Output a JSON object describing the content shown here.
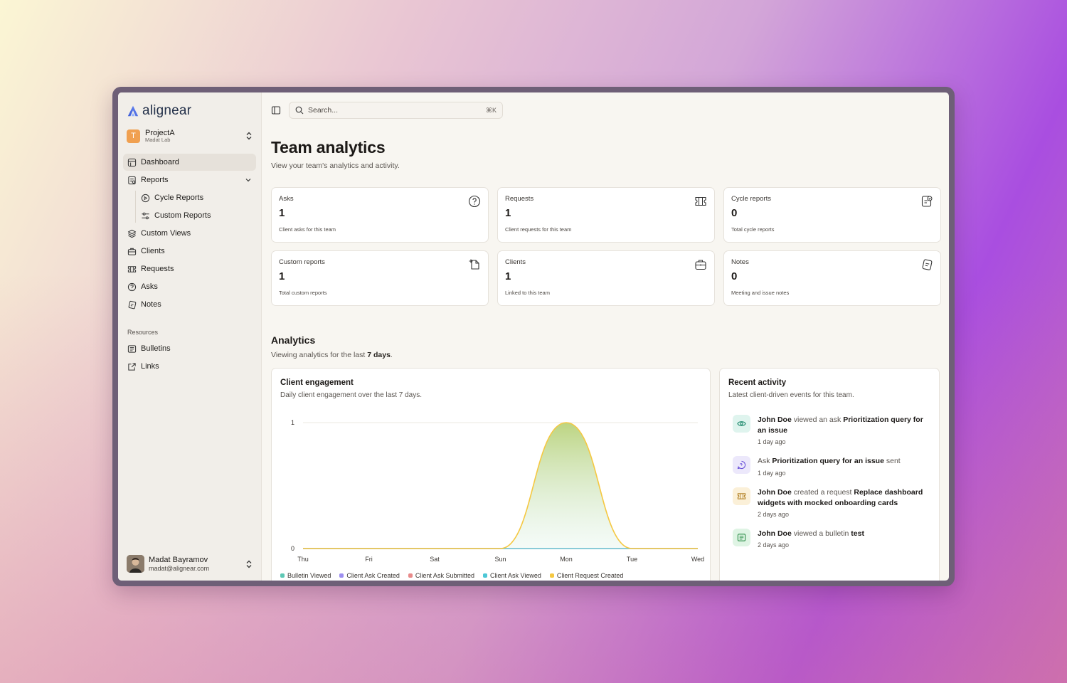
{
  "app": {
    "brand": "alignear",
    "project": {
      "initial": "T",
      "name": "ProjectA",
      "org": "Madat Lab"
    },
    "user": {
      "name": "Madat Bayramov",
      "email": "madat@alignear.com"
    }
  },
  "sidebar": {
    "items": [
      {
        "label": "Dashboard",
        "icon": "dashboard-icon",
        "active": true
      },
      {
        "label": "Reports",
        "icon": "reports-icon"
      },
      {
        "label": "Cycle Reports",
        "icon": "cycle-icon"
      },
      {
        "label": "Custom Reports",
        "icon": "sliders-icon"
      },
      {
        "label": "Custom Views",
        "icon": "layers-icon"
      },
      {
        "label": "Clients",
        "icon": "briefcase-icon"
      },
      {
        "label": "Requests",
        "icon": "ticket-icon"
      },
      {
        "label": "Asks",
        "icon": "help-circle-icon"
      },
      {
        "label": "Notes",
        "icon": "notes-icon"
      }
    ],
    "resources_label": "Resources",
    "resources": [
      {
        "label": "Bulletins",
        "icon": "newspaper-icon"
      },
      {
        "label": "Links",
        "icon": "external-link-icon"
      }
    ]
  },
  "topbar": {
    "search_placeholder": "Search...",
    "shortcut": "⌘K"
  },
  "page": {
    "title": "Team analytics",
    "subtitle": "View your team's analytics and activity."
  },
  "stats": [
    {
      "title": "Asks",
      "value": "1",
      "desc": "Client asks for this team",
      "icon": "help-circle-icon"
    },
    {
      "title": "Requests",
      "value": "1",
      "desc": "Client requests for this team",
      "icon": "ticket-icon"
    },
    {
      "title": "Cycle reports",
      "value": "0",
      "desc": "Total cycle reports",
      "icon": "report-check-icon"
    },
    {
      "title": "Custom reports",
      "value": "1",
      "desc": "Total custom reports",
      "icon": "file-plus-icon"
    },
    {
      "title": "Clients",
      "value": "1",
      "desc": "Linked to this team",
      "icon": "briefcase-icon"
    },
    {
      "title": "Notes",
      "value": "0",
      "desc": "Meeting and issue notes",
      "icon": "notes-icon"
    }
  ],
  "analytics": {
    "title": "Analytics",
    "subtitle_prefix": "Viewing analytics for the last",
    "subtitle_range": "7 days",
    "subtitle_suffix": "."
  },
  "engagement": {
    "title": "Client engagement",
    "subtitle": "Daily client engagement over the last 7 days."
  },
  "chart_data": {
    "type": "area",
    "title": "Client engagement",
    "categories": [
      "Thu",
      "Fri",
      "Sat",
      "Sun",
      "Mon",
      "Tue",
      "Wed"
    ],
    "y_ticks": [
      "0",
      "1"
    ],
    "ylim": [
      0,
      1
    ],
    "series": [
      {
        "name": "Bulletin Viewed",
        "color": "#5ec8b5",
        "values": [
          0,
          0,
          0,
          0,
          0,
          0,
          0
        ]
      },
      {
        "name": "Client Ask Created",
        "color": "#9d8ff0",
        "values": [
          0,
          0,
          0,
          0,
          0,
          0,
          0
        ]
      },
      {
        "name": "Client Ask Submitted",
        "color": "#e88a8a",
        "values": [
          0,
          0,
          0,
          0,
          0,
          0,
          0
        ]
      },
      {
        "name": "Client Ask Viewed",
        "color": "#4cc7d6",
        "values": [
          0,
          0,
          0,
          0,
          0,
          0,
          0
        ]
      },
      {
        "name": "Client Request Created",
        "color": "#f5c842",
        "values": [
          0,
          0,
          0,
          0,
          1,
          0,
          0
        ]
      }
    ],
    "grid": true,
    "legend": "bottom"
  },
  "activity": {
    "title": "Recent activity",
    "subtitle": "Latest client-driven events for this team.",
    "items": [
      {
        "icon": "eye-icon",
        "bg": "#dff4ee",
        "fg": "#1f8a6e",
        "actor": "John Doe",
        "verb": "viewed an ask",
        "object": "Prioritization query for an issue",
        "tail": "",
        "time": "1 day ago"
      },
      {
        "icon": "message-icon",
        "bg": "#ece8fb",
        "fg": "#6a52d9",
        "actor": "",
        "verb": "Ask",
        "object": "Prioritization query for an issue",
        "tail": "sent",
        "time": "1 day ago"
      },
      {
        "icon": "ticket-icon",
        "bg": "#fbf0d8",
        "fg": "#b5842a",
        "actor": "John Doe",
        "verb": "created a request",
        "object": "Replace dashboard widgets with mocked onboarding cards",
        "tail": "",
        "time": "2 days ago"
      },
      {
        "icon": "newspaper-icon",
        "bg": "#dff4e4",
        "fg": "#2f8f4a",
        "actor": "John Doe",
        "verb": "viewed a bulletin",
        "object": "test",
        "tail": "",
        "time": "2 days ago"
      }
    ]
  }
}
